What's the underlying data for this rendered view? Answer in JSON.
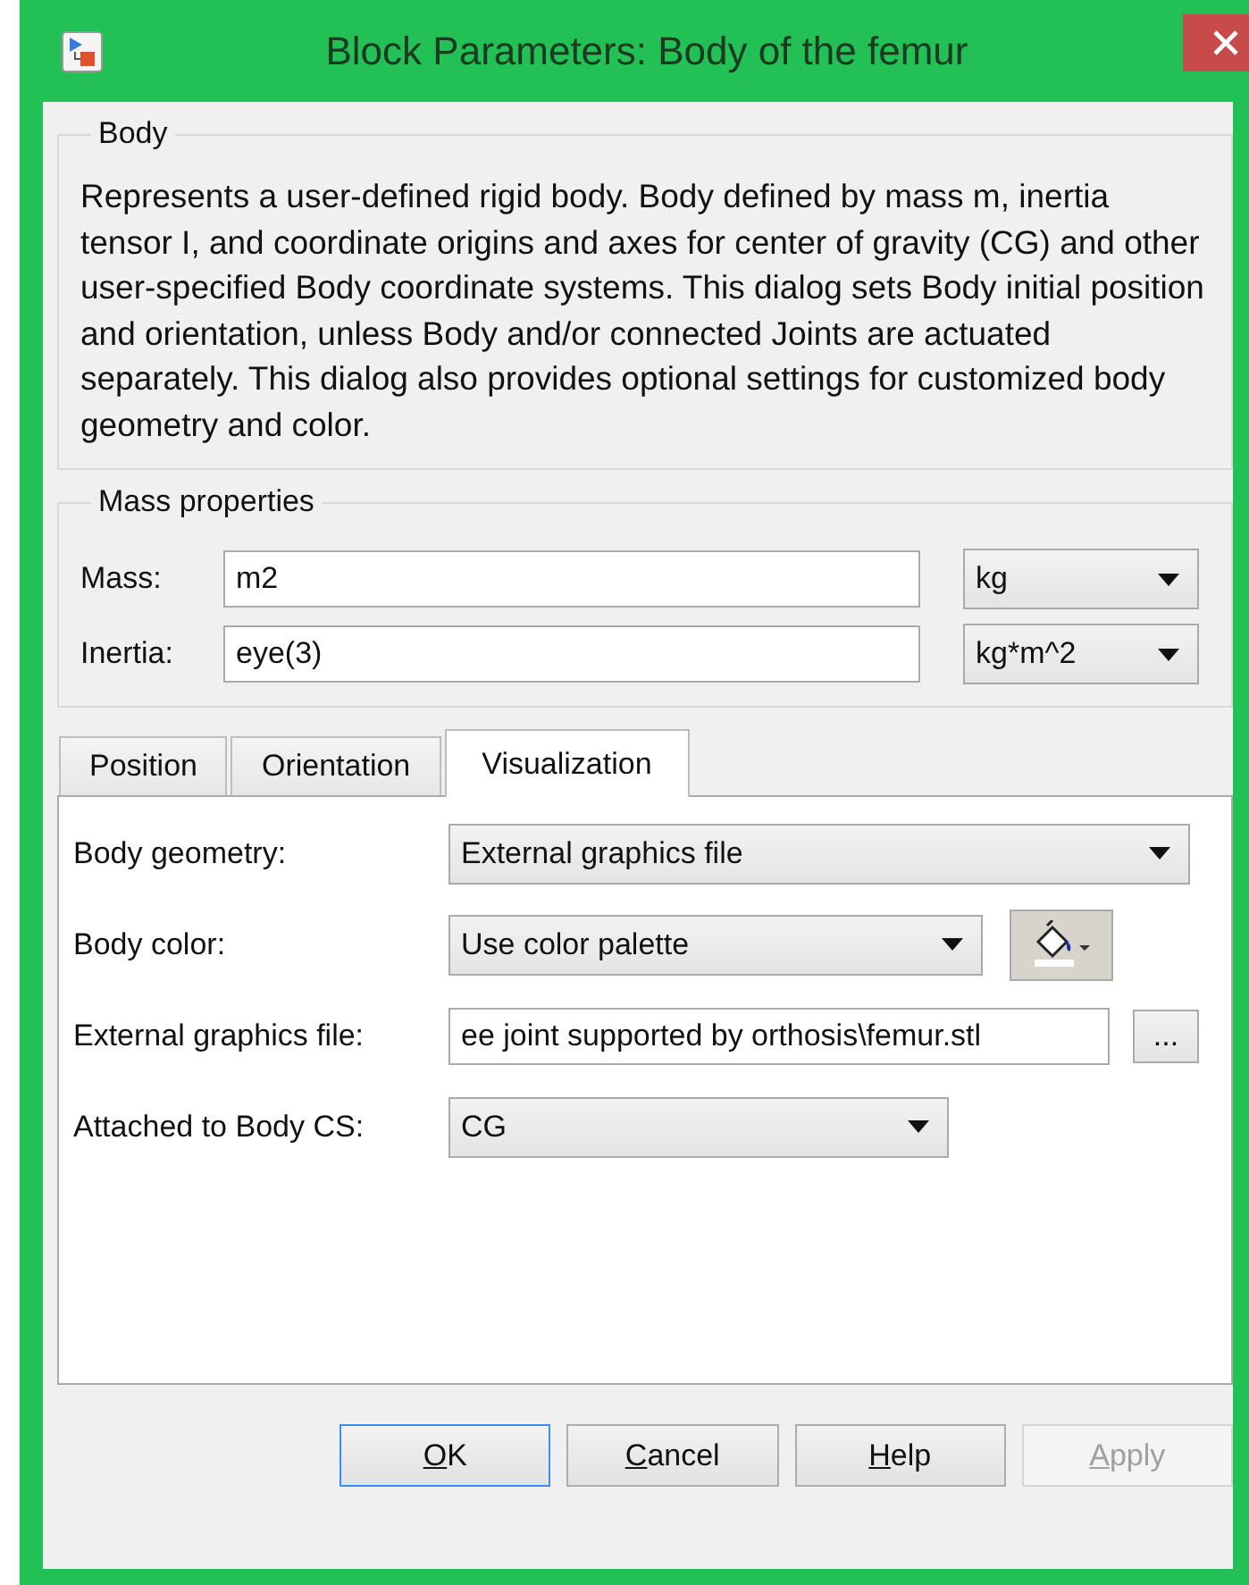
{
  "window": {
    "title": "Block Parameters: Body of the femur"
  },
  "body_group": {
    "title": "Body",
    "description": "Represents a user-defined rigid body. Body defined by mass m, inertia tensor I, and coordinate origins and axes for center of gravity (CG) and other user-specified Body coordinate systems. This dialog sets Body initial position and orientation, unless Body and/or connected Joints are actuated separately. This dialog also provides optional settings for customized body geometry and color."
  },
  "mass_group": {
    "title": "Mass properties",
    "rows": [
      {
        "label": "Mass:",
        "value": "m2",
        "unit": "kg"
      },
      {
        "label": "Inertia:",
        "value": "eye(3)",
        "unit": "kg*m^2"
      }
    ]
  },
  "tabs": [
    {
      "label": "Position",
      "selected": false
    },
    {
      "label": "Orientation",
      "selected": false
    },
    {
      "label": "Visualization",
      "selected": true
    }
  ],
  "visualization": [
    {
      "kind": "dropdown",
      "label": "Body geometry:",
      "value": "External graphics file"
    },
    {
      "kind": "color",
      "label": "Body color:",
      "value": "Use color palette"
    },
    {
      "kind": "file",
      "label": "External graphics file:",
      "value": "ee joint supported by orthosis\\femur.stl",
      "browse": "..."
    },
    {
      "kind": "short_dropdown",
      "label": "Attached to Body CS:",
      "value": "CG"
    }
  ],
  "buttons": [
    {
      "mnemonic": "O",
      "rest": "K",
      "default": true,
      "disabled": false
    },
    {
      "mnemonic": "C",
      "rest": "ancel",
      "default": false,
      "disabled": false
    },
    {
      "mnemonic": "H",
      "rest": "elp",
      "default": false,
      "disabled": false
    },
    {
      "mnemonic": "A",
      "rest": "pply",
      "default": false,
      "disabled": true
    }
  ]
}
